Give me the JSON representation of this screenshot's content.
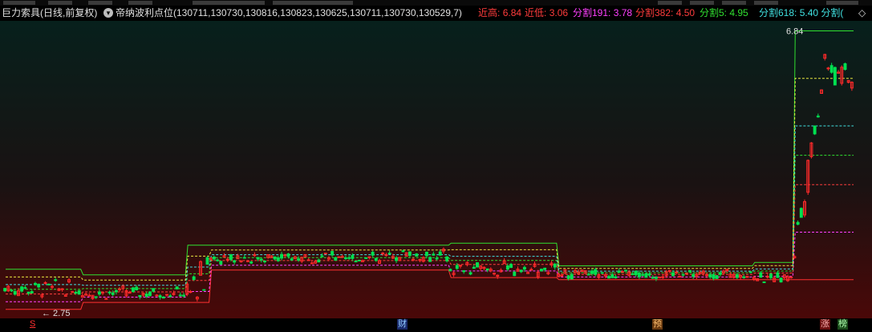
{
  "header": {
    "stock_name": "巨力索具(日线,前复权)",
    "formula_icon": "chevron-down-icon",
    "formula": "帝纳波利点位(130711,130730,130816,130823,130625,130711,130730,130529,7)",
    "recent_high_label": "近高:",
    "recent_high_value": "6.84",
    "recent_low_label": "近低:",
    "recent_low_value": "3.06",
    "split191_label": "分割191:",
    "split191_value": "3.78",
    "split382_label": "分割382:",
    "split382_value": "4.50",
    "split5_label": "分割5:",
    "split5_value": "4.95",
    "split618_label": "分割618:",
    "split618_value": "5.40",
    "split_more": "分割(",
    "diamond_icon": "◇"
  },
  "markers": {
    "s": "S",
    "cai": "财",
    "yu": "预",
    "zhang": "涨",
    "bang": "榜"
  },
  "chart_data": {
    "type": "candlestick",
    "annotations": {
      "max_label": "6.84",
      "min_label": "2.75"
    },
    "colors": {
      "up": "#ff2a2a",
      "down": "#00e050",
      "bg_top": "#07201c",
      "bg_bottom": "#4a0808"
    },
    "level_lines": [
      {
        "name": "近高",
        "color": "#30e030",
        "style": "solid"
      },
      {
        "name": "近低",
        "color": "#ff3030",
        "style": "solid"
      },
      {
        "name": "分割191",
        "color": "#ff40ff",
        "style": "dashed"
      },
      {
        "name": "分割382",
        "color": "#ff3c3c",
        "style": "dashed"
      },
      {
        "name": "分割5",
        "color": "#30e030",
        "style": "dashed"
      },
      {
        "name": "分割618",
        "color": "#40e0e0",
        "style": "dashed"
      },
      {
        "name": "extra",
        "color": "#e8e840",
        "style": "dashed"
      }
    ],
    "segments": [
      {
        "n": 23,
        "high": 3.38,
        "low": 2.8,
        "p": 3.1
      },
      {
        "n": 31,
        "high": 3.3,
        "low": 2.9,
        "p": 3.04
      },
      {
        "n": 7,
        "high": 3.73,
        "low": 2.9,
        "p": 3.28
      },
      {
        "n": 54,
        "high": 3.73,
        "low": 3.37,
        "p": 3.55
      },
      {
        "n": 17,
        "high": 3.73,
        "low": 3.37,
        "p": 3.58
      },
      {
        "n": 32,
        "high": 3.76,
        "low": 3.26,
        "p": 3.38
      },
      {
        "n": 58,
        "high": 3.43,
        "low": 3.23,
        "p": 3.31
      },
      {
        "n": 12,
        "high": 3.48,
        "low": 3.23,
        "p": 3.26
      },
      {
        "n": 10,
        "high": 6.84,
        "low": 3.23,
        "p": 6.4
      },
      {
        "n": 8,
        "high": 6.84,
        "low": 3.23,
        "p": 6.1
      }
    ]
  }
}
